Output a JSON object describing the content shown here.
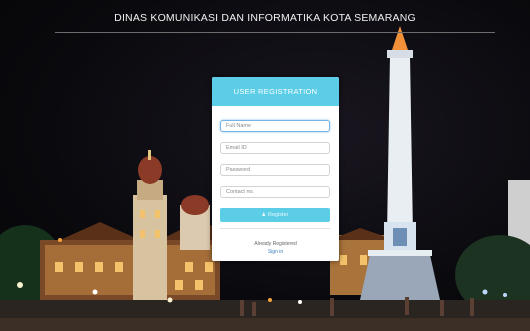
{
  "header": {
    "title": "DINAS KOMUNIKASI DAN INFORMATIKA KOTA SEMARANG"
  },
  "form": {
    "title": "USER REGISTRATION",
    "full_name_placeholder": "Full Name",
    "email_placeholder": "Email ID",
    "password_placeholder": "Password",
    "contact_placeholder": "Contact no.",
    "register_label": "Register",
    "already_text": "Already Registered",
    "signin_label": "Sign in"
  },
  "icons": {
    "register": "user-icon"
  },
  "colors": {
    "accent": "#5bcde6",
    "background": "#0a0a0e",
    "link": "#3a7fc0"
  }
}
